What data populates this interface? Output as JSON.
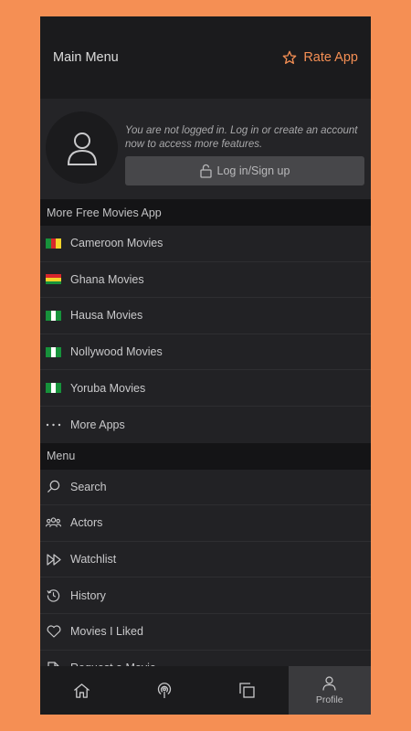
{
  "header": {
    "title": "Main Menu",
    "rate_label": "Rate App",
    "accent": "#f58f54"
  },
  "profile": {
    "message": "You are not logged in. Log in or create an account now to access more features.",
    "login_label": "Log in/Sign up"
  },
  "apps_section": {
    "title": "More Free Movies App",
    "items": [
      {
        "label": "Cameroon Movies",
        "icon": "cameroon-flag-icon"
      },
      {
        "label": "Ghana Movies",
        "icon": "ghana-flag-icon"
      },
      {
        "label": "Hausa Movies",
        "icon": "nigeria-flag-icon"
      },
      {
        "label": "Nollywood Movies",
        "icon": "nigeria-flag-icon"
      },
      {
        "label": "Yoruba Movies",
        "icon": "nigeria-flag-icon"
      },
      {
        "label": "More Apps",
        "icon": "more-dots-icon"
      }
    ]
  },
  "menu_section": {
    "title": "Menu",
    "items": [
      {
        "label": "Search",
        "icon": "search-icon"
      },
      {
        "label": "Actors",
        "icon": "actors-icon"
      },
      {
        "label": "Watchlist",
        "icon": "fast-forward-icon"
      },
      {
        "label": "History",
        "icon": "history-icon"
      },
      {
        "label": "Movies I Liked",
        "icon": "heart-icon"
      },
      {
        "label": "Request a Movie",
        "icon": "document-icon"
      }
    ]
  },
  "bottom_nav": {
    "items": [
      {
        "label": "",
        "icon": "home-icon"
      },
      {
        "label": "",
        "icon": "podcast-icon"
      },
      {
        "label": "",
        "icon": "copy-icon"
      },
      {
        "label": "Profile",
        "icon": "profile-icon"
      }
    ],
    "active": "Profile"
  }
}
